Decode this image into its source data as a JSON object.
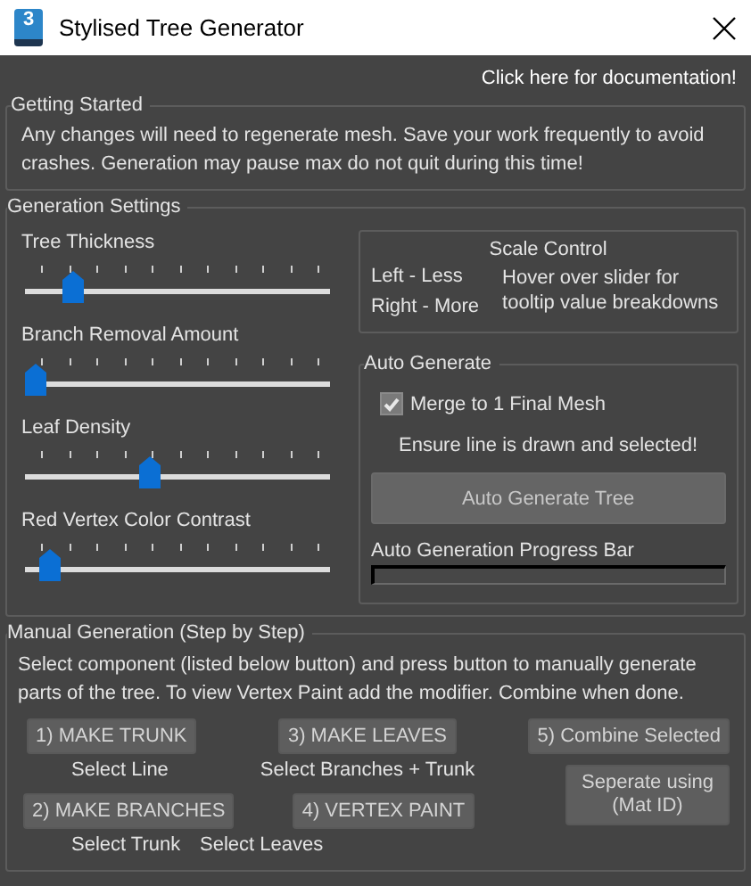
{
  "window": {
    "icon_text": "3",
    "title": "Stylised Tree Generator"
  },
  "documentation_link": "Click here for documentation!",
  "getting_started": {
    "title": "Getting Started",
    "text": "Any changes will need to regenerate mesh. Save your work frequently to avoid crashes. Generation may pause max do not quit during this time!"
  },
  "generation_settings": {
    "title": "Generation Settings",
    "sliders": [
      {
        "label": "Tree Thickness",
        "level": 0.13
      },
      {
        "label": "Branch Removal Amount",
        "level": 0
      },
      {
        "label": "Leaf Density",
        "level": 0.4
      },
      {
        "label": "Red Vertex Color Contrast",
        "level": 0.05
      }
    ],
    "scale_control": {
      "title": "Scale Control",
      "left": "Left - Less",
      "right": "Right - More",
      "hint": "Hover over slider for tooltip value breakdowns"
    },
    "auto_generate": {
      "title": "Auto Generate",
      "merge_checkbox": {
        "label": "Merge to 1 Final Mesh",
        "checked": true
      },
      "note": "Ensure line is drawn and selected!",
      "button": "Auto Generate Tree",
      "progress_label": "Auto Generation Progress Bar",
      "progress": {
        "level": 0
      }
    }
  },
  "manual_generation": {
    "title": "Manual Generation (Step by Step)",
    "text": "Select component (listed below button) and press button to manually generate parts of the tree. To view Vertex Paint add the modifier. Combine when done.",
    "steps": [
      {
        "button": "1) MAKE TRUNK",
        "hint": "Select Line"
      },
      {
        "button": "2) MAKE BRANCHES",
        "hint": "Select Trunk"
      },
      {
        "button": "3) MAKE LEAVES",
        "hint": "Select Branches + Trunk"
      },
      {
        "button": "4) VERTEX PAINT",
        "hint": "Select Leaves"
      }
    ],
    "buttons": [
      "5) Combine Selected",
      "Seperate using (Mat ID)"
    ]
  }
}
